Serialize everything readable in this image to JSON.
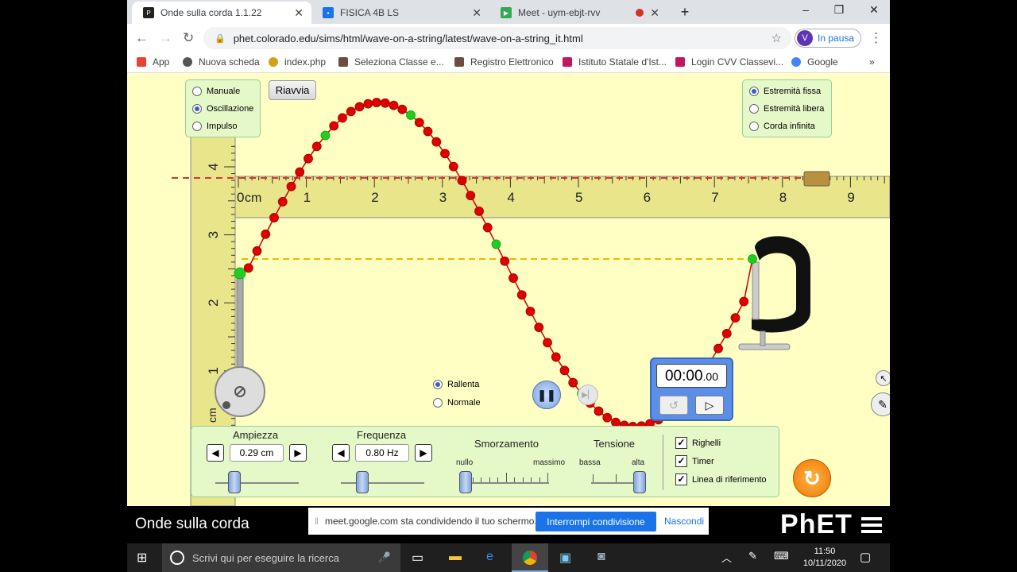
{
  "tabs": [
    {
      "title": "Onde sulla corda 1.1.22",
      "active": true,
      "icon": "phet-favicon"
    },
    {
      "title": "FISICA 4B LS",
      "active": false,
      "icon": "classroom-favicon"
    },
    {
      "title": "Meet - uym-ebjt-rvv",
      "active": false,
      "icon": "meet-favicon",
      "recording": true
    }
  ],
  "window_controls": {
    "minimize": "–",
    "maximize": "❐",
    "close": "✕",
    "newtab": "+"
  },
  "address": {
    "url": "phet.colorado.edu/sims/html/wave-on-a-string/latest/wave-on-a-string_it.html",
    "profile_initial": "V",
    "profile_status": "In pausa"
  },
  "bookmarks": [
    "App",
    "Nuova scheda",
    "index.php",
    "Seleziona Classe e...",
    "Registro Elettronico",
    "Istituto Statale d'Ist...",
    "Login CVV Classevi...",
    "Google"
  ],
  "sim": {
    "mode_options": [
      {
        "label": "Manuale",
        "selected": false
      },
      {
        "label": "Oscillazione",
        "selected": true
      },
      {
        "label": "Impulso",
        "selected": false
      }
    ],
    "restart_label": "Riavvia",
    "end_options": [
      {
        "label": "Estremità fissa",
        "selected": true
      },
      {
        "label": "Estremità libera",
        "selected": false
      },
      {
        "label": "Corda infinita",
        "selected": false
      }
    ],
    "h_ruler_ticks": [
      "0",
      "1",
      "2",
      "3",
      "4",
      "5",
      "6",
      "7",
      "8",
      "9"
    ],
    "h_ruler_unit": "cm",
    "v_ruler_ticks": [
      "4",
      "3",
      "2",
      "1"
    ],
    "v_ruler_unit": "cm",
    "speed_options": [
      {
        "label": "Rallenta",
        "selected": true
      },
      {
        "label": "Normale",
        "selected": false
      }
    ],
    "timer": {
      "main": "00:00",
      "fraction": ".00"
    },
    "controls": {
      "amplitude": {
        "label": "Ampiezza",
        "value": "0.29 cm"
      },
      "frequency": {
        "label": "Frequenza",
        "value": "0.80 Hz"
      },
      "damping": {
        "label": "Smorzamento",
        "min": "nullo",
        "max": "massimo",
        "level": 0.0
      },
      "tension": {
        "label": "Tensione",
        "min": "bassa",
        "max": "alta",
        "level": 1.0
      }
    },
    "checkboxes": [
      {
        "label": "Righelli",
        "checked": true
      },
      {
        "label": "Timer",
        "checked": true
      },
      {
        "label": "Linea di riferimento",
        "checked": true
      }
    ],
    "title": "Onde sulla corda",
    "logo": "PhET"
  },
  "share_bar": {
    "message": "meet.google.com sta condividendo il tuo schermo.",
    "stop_label": "Interrompi condivisione",
    "hide_label": "Nascondi"
  },
  "taskbar": {
    "search_placeholder": "Scrivi qui per eseguire la ricerca",
    "time": "11:50",
    "date": "10/11/2020"
  },
  "colors": {
    "sim_bg": "#ffffc4",
    "panel_bg": "#e5f8c8",
    "bead": "#e00000",
    "bead_marker": "#22cc22",
    "reference_line": "#f0b800",
    "ruler": "#e9e58a"
  }
}
